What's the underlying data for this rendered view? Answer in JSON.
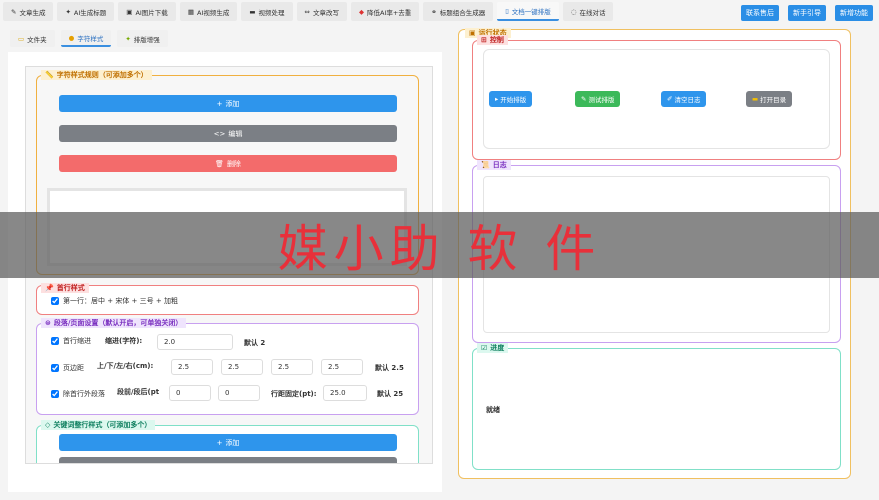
{
  "top_tabs": [
    {
      "label": "文章生成",
      "icon": "edit-icon"
    },
    {
      "label": "AI生成标题",
      "icon": "bulb-icon"
    },
    {
      "label": "AI图片下载",
      "icon": "image-icon"
    },
    {
      "label": "AI视频生成",
      "icon": "video-icon"
    },
    {
      "label": "视频处理",
      "icon": "film-icon"
    },
    {
      "label": "文章改写",
      "icon": "code-icon"
    },
    {
      "label": "降低AI率+去重",
      "icon": "shield-icon"
    },
    {
      "label": "标题组合生成器",
      "icon": "link-icon"
    },
    {
      "label": "文档一键排版",
      "icon": "doc-icon",
      "active": true
    },
    {
      "label": "在线对话",
      "icon": "chat-icon"
    }
  ],
  "top_buttons": [
    "联系售后",
    "新手引导",
    "新增功能"
  ],
  "sub_tabs": [
    {
      "label": "文件夹",
      "icon": "folder-icon"
    },
    {
      "label": "字符样式",
      "icon": "palette-icon",
      "active": true
    },
    {
      "label": "排版增强",
      "icon": "bulb-icon"
    }
  ],
  "char_rules": {
    "title": "字符样式规则（可添加多个）",
    "add": "添加",
    "edit": "编辑",
    "delete": "删除"
  },
  "first_line": {
    "title": "首行样式",
    "check": "第一行：居中 + 宋体 + 三号 + 加粗"
  },
  "para": {
    "title": "段落/页面设置（默认开启，可单独关闭）",
    "indent": {
      "check": "首行缩进",
      "label": "缩进(字符):",
      "value": "2.0",
      "default": "默认 2"
    },
    "margin": {
      "check": "页边距",
      "label": "上/下/左/右(cm):",
      "values": [
        "2.5",
        "2.5",
        "2.5",
        "2.5"
      ],
      "default": "默认 2.5"
    },
    "spacing": {
      "check": "除首行外段落",
      "label": "段前/段后(pt",
      "values": [
        "0",
        "0"
      ],
      "line_label": "行距固定(pt):",
      "line_value": "25.0",
      "default": "默认 25"
    }
  },
  "keyword": {
    "title": "关键词整行样式（可添加多个）",
    "add": "添加"
  },
  "status": {
    "title": "运行状态",
    "control": "控制",
    "buttons": [
      "开始排版",
      "测试排版",
      "清空日志",
      "打开目录"
    ],
    "log": "日志",
    "progress": "进度",
    "progress_text": "就绪"
  },
  "watermark": "媒小助 软 件",
  "colors": {
    "accent": "#2a8ee6",
    "danger": "#f36b6b",
    "success": "#3cb95a",
    "gray": "#7b7f85"
  }
}
